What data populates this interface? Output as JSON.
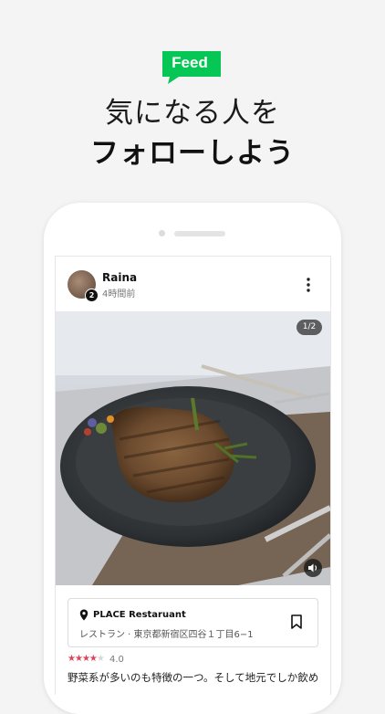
{
  "badge": {
    "label": "Feed",
    "color": "#06c755"
  },
  "headline": {
    "line1": "気になる人を",
    "line2": "フォローしよう"
  },
  "post": {
    "user_name": "Raina",
    "time": "4時間前",
    "avatar_count": "2",
    "photo_indicator": "1/2",
    "place": {
      "name": "PLACE Restaruant",
      "address": "レストラン · 東京都新宿区四谷１丁目6−1"
    },
    "rating": {
      "stars": 3.5,
      "value": "4.0"
    },
    "review": "野菜系が多いのも特徴の一つ。そして地元でしか飲め"
  },
  "icons": [
    "more-vertical-icon",
    "sound-icon",
    "location-pin-icon",
    "bookmark-icon",
    "star-icon"
  ]
}
